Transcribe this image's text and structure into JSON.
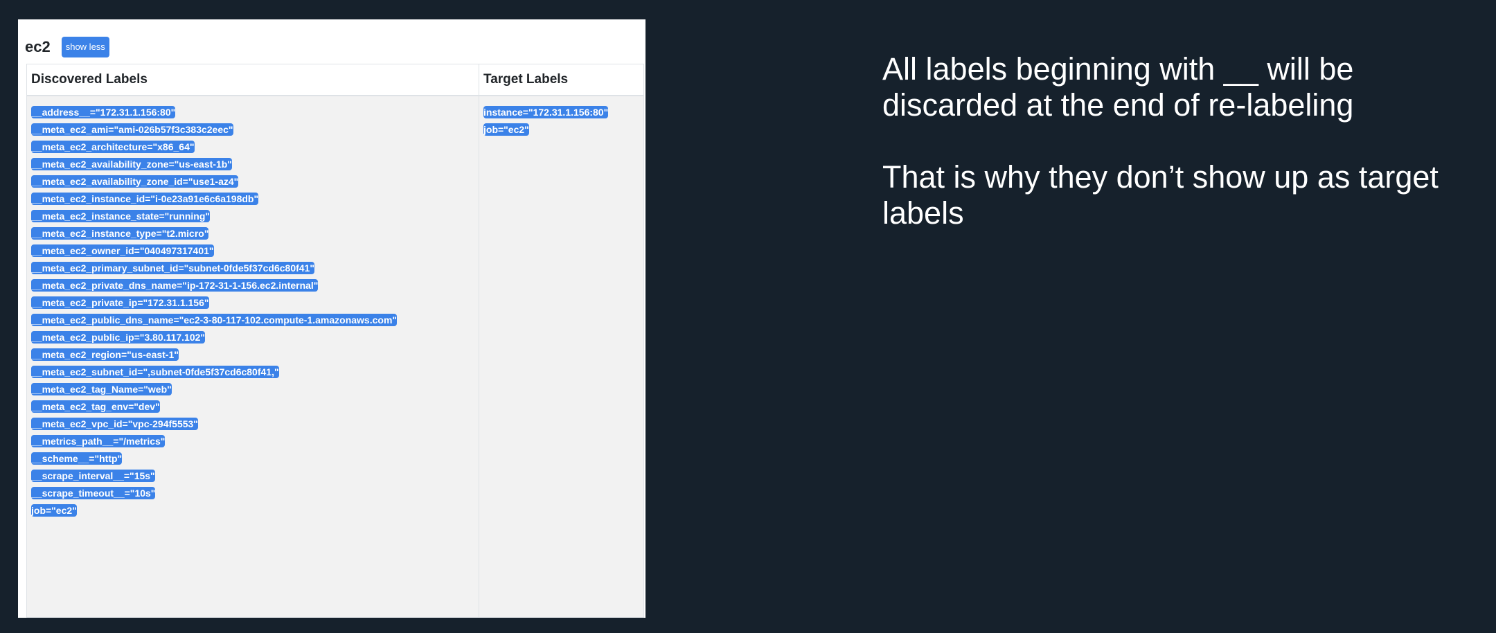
{
  "panel": {
    "job_name": "ec2",
    "toggle_label": "show less",
    "headers": {
      "discovered": "Discovered Labels",
      "target": "Target Labels"
    },
    "discovered_labels": [
      "__address__=\"172.31.1.156:80\"",
      "__meta_ec2_ami=\"ami-026b57f3c383c2eec\"",
      "__meta_ec2_architecture=\"x86_64\"",
      "__meta_ec2_availability_zone=\"us-east-1b\"",
      "__meta_ec2_availability_zone_id=\"use1-az4\"",
      "__meta_ec2_instance_id=\"i-0e23a91e6c6a198db\"",
      "__meta_ec2_instance_state=\"running\"",
      "__meta_ec2_instance_type=\"t2.micro\"",
      "__meta_ec2_owner_id=\"040497317401\"",
      "__meta_ec2_primary_subnet_id=\"subnet-0fde5f37cd6c80f41\"",
      "__meta_ec2_private_dns_name=\"ip-172-31-1-156.ec2.internal\"",
      "__meta_ec2_private_ip=\"172.31.1.156\"",
      "__meta_ec2_public_dns_name=\"ec2-3-80-117-102.compute-1.amazonaws.com\"",
      "__meta_ec2_public_ip=\"3.80.117.102\"",
      "__meta_ec2_region=\"us-east-1\"",
      "__meta_ec2_subnet_id=\",subnet-0fde5f37cd6c80f41,\"",
      "__meta_ec2_tag_Name=\"web\"",
      "__meta_ec2_tag_env=\"dev\"",
      "__meta_ec2_vpc_id=\"vpc-294f5553\"",
      "__metrics_path__=\"/metrics\"",
      "__scheme__=\"http\"",
      "__scrape_interval__=\"15s\"",
      "__scrape_timeout__=\"10s\"",
      "job=\"ec2\""
    ],
    "target_labels": [
      "instance=\"172.31.1.156:80\"",
      "job=\"ec2\""
    ]
  },
  "explanation": {
    "line1": "All labels beginning with __ will be discarded at the end of re-labeling",
    "line2": "That is why they don’t show up as target labels"
  },
  "colors": {
    "background": "#16212c",
    "badge": "#3b82e8",
    "cell_background": "#f2f2f2"
  }
}
